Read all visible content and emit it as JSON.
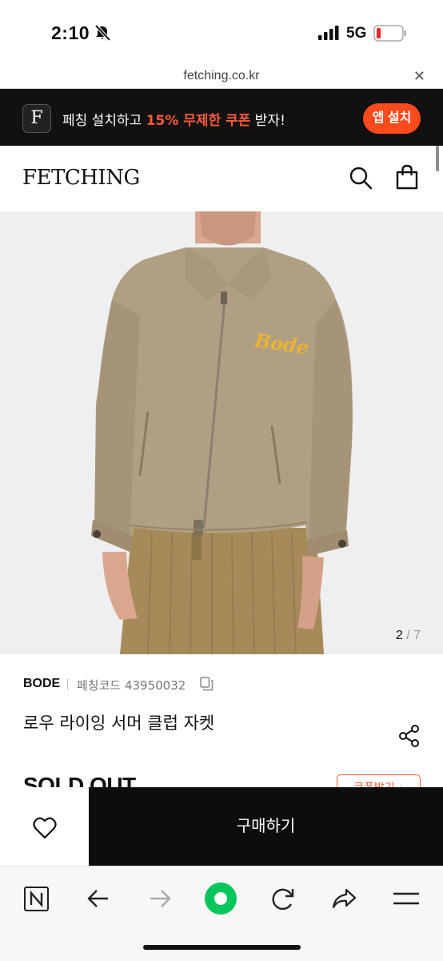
{
  "status_bar": {
    "time": "2:10",
    "network": "5G"
  },
  "browser": {
    "url": "fetching.co.kr",
    "close_label": "✕"
  },
  "app_banner": {
    "logo_letter": "F",
    "text_before": "페칭 설치하고 ",
    "text_highlight": "15% 무제한 쿠폰",
    "text_after": " 받자!",
    "install_label": "앱 설치",
    "accent_color": "#ff4a1c"
  },
  "header": {
    "brand": "FETCHING",
    "icons": [
      "search-icon",
      "shopping-bag-icon"
    ]
  },
  "gallery": {
    "current": "2",
    "total": " / 7",
    "print_text": "Bode"
  },
  "product": {
    "brand": "BODE",
    "code_label": "페칭코드 43950032",
    "name": "로우 라이잉 서머 클럽 자켓",
    "status": "SOLD OUT",
    "coupon_label": "쿠폰받기 ↓"
  },
  "buy_bar": {
    "buy_label": "구매하기"
  },
  "browser_toolbar": {
    "items": [
      "naver-home-icon",
      "back-arrow-icon",
      "forward-arrow-icon",
      "green-dot-icon",
      "refresh-icon",
      "share-arrow-icon",
      "menu-icon"
    ]
  }
}
